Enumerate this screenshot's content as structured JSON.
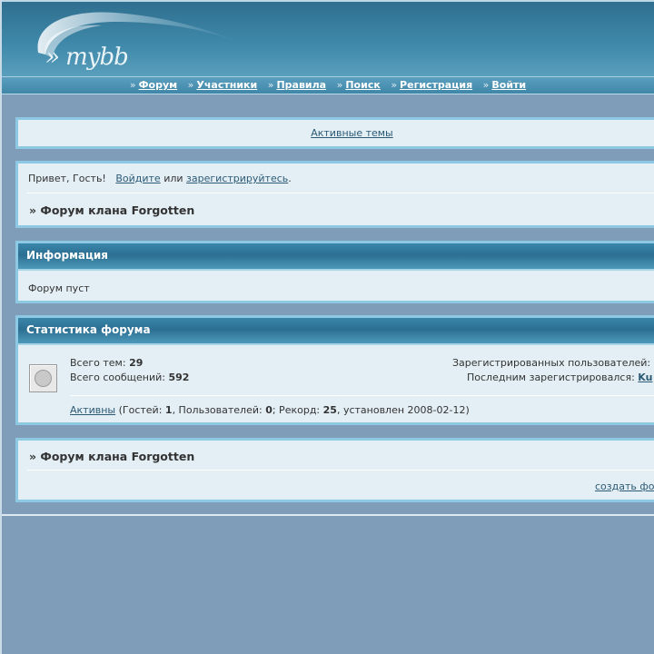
{
  "header": {
    "logo_text": "» mybb",
    "nav": [
      {
        "label": "Форум"
      },
      {
        "label": "Участники"
      },
      {
        "label": "Правила"
      },
      {
        "label": "Поиск"
      },
      {
        "label": "Регистрация"
      },
      {
        "label": "Войти"
      }
    ],
    "nav_separator": "»"
  },
  "active_topics": {
    "link": "Активные темы"
  },
  "welcome": {
    "greeting": "Привет, Гость!",
    "login_link": "Войдите",
    "or_text": "или",
    "register_link": "зарегистрируйтесь",
    "period": ".",
    "breadcrumb": "» Форум клана Forgotten"
  },
  "info": {
    "title": "Информация",
    "text": "Форум пуст"
  },
  "stats": {
    "title": "Статистика форума",
    "topics_label": "Всего тем:",
    "topics_value": "29",
    "posts_label": "Всего сообщений:",
    "posts_value": "592",
    "registered_label": "Зарегистрированных пользователей:",
    "last_registered_label": "Последним зарегистрировался:",
    "last_registered_value": "Ku",
    "active_link": "Активны",
    "guests_label": "(Гостей:",
    "guests_value": "1",
    "users_label": ", Пользователей:",
    "users_value": "0",
    "record_label": "; Рекорд:",
    "record_value": "25",
    "record_date": ", установлен 2008-02-12)"
  },
  "forum": {
    "breadcrumb": "» Форум клана Forgotten",
    "create_link": "создать фо"
  },
  "colors": {
    "background": "#7f9db9",
    "panel": "#e4eff5",
    "panel_border": "#8ec9e3",
    "header": "#3f88a9",
    "link": "#2c5a75"
  }
}
